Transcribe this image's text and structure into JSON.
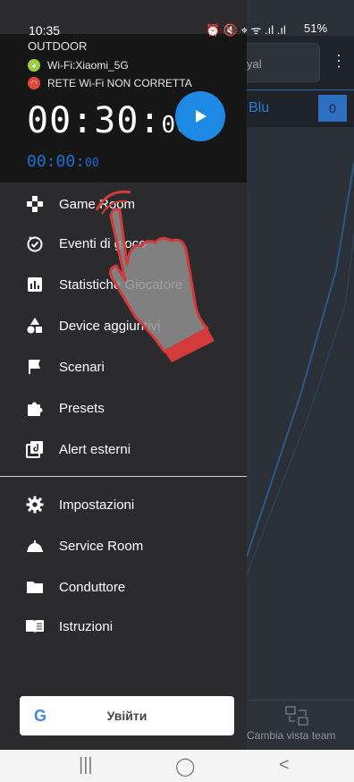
{
  "status_bar": {
    "time": "10:35",
    "icons": "⏰ 🔇 ⌖ ᯤ .ıl .ıl",
    "battery": "51%"
  },
  "background_app": {
    "title_partial": "yal",
    "team_name": "Blu",
    "team_score": "0",
    "switch_view_label": "Cambia vista team"
  },
  "drawer": {
    "mode": "OUTDOOR",
    "wifi_ok_label": "Wi-Fi:Xiaomi_5G",
    "wifi_bad_label": "RETE Wi-Fi NON CORRETTA",
    "timer_main": "00:30:",
    "timer_main_small": "00",
    "timer_sub": "00:00:",
    "timer_sub_small": "00",
    "menu": [
      {
        "label": "Game Room",
        "icon": "gamepad-icon"
      },
      {
        "label": "Eventi di gioco",
        "icon": "timer-check-icon"
      },
      {
        "label": "Statistiche Giocatore",
        "icon": "stats-icon"
      },
      {
        "label": "Device aggiuntivi",
        "icon": "shapes-icon"
      },
      {
        "label": "Scenari",
        "icon": "flag-icon"
      },
      {
        "label": "Presets",
        "icon": "puzzle-icon"
      },
      {
        "label": "Alert esterni",
        "icon": "alert-icon"
      },
      {
        "label": "Impostazioni",
        "icon": "gear-icon"
      },
      {
        "label": "Service Room",
        "icon": "bell-icon"
      },
      {
        "label": "Conduttore",
        "icon": "folder-icon"
      },
      {
        "label": "Istruzioni",
        "icon": "book-icon"
      }
    ],
    "google_letter": "G",
    "google_button_label": "Увійти"
  },
  "nav": {
    "recents": "|||",
    "home": "◯",
    "back": "<"
  },
  "colors": {
    "accent": "#1e88e5",
    "timer_sub": "#1e6fd2",
    "wifi_ok": "#9ccc45",
    "wifi_bad": "#e0443a"
  }
}
